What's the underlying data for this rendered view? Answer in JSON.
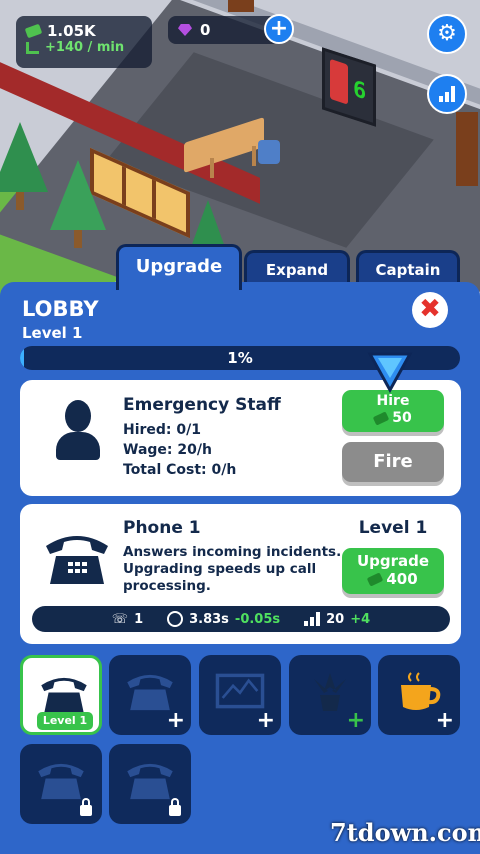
{
  "hud": {
    "money": "1.05K",
    "rate": "+140 / min",
    "gems": "0",
    "add_label": "+",
    "settings_icon": "gear-icon",
    "stats_icon": "bar-chart-icon"
  },
  "scene": {
    "counter_value": "6"
  },
  "tabs": [
    {
      "label": "Upgrade",
      "active": true
    },
    {
      "label": "Expand",
      "active": false
    },
    {
      "label": "Captain",
      "active": false
    }
  ],
  "panel": {
    "title": "LOBBY",
    "level": "Level 1",
    "progress_pct": 1,
    "progress_label": "1%",
    "close_label": "✖"
  },
  "staff": {
    "name": "Emergency Staff",
    "hired": "Hired: 0/1",
    "wage": "Wage: 20/h",
    "total_cost": "Total Cost: 0/h",
    "hire_label": "Hire",
    "hire_cost": "50",
    "fire_label": "Fire"
  },
  "item": {
    "name": "Phone 1",
    "level": "Level 1",
    "desc_line1": "Answers incoming incidents.",
    "desc_line2": "Upgrading speeds up call",
    "desc_line3": "processing.",
    "upgrade_label": "Upgrade",
    "upgrade_cost": "400",
    "stat_calls": "1",
    "stat_time": "3.83s",
    "stat_time_delta": "-0.05s",
    "stat_income": "20",
    "stat_income_delta": "+4"
  },
  "slots": [
    {
      "icon": "phone-icon",
      "state": "selected",
      "badge": "Level 1"
    },
    {
      "icon": "phone-icon",
      "state": "buy"
    },
    {
      "icon": "map-icon",
      "state": "buy"
    },
    {
      "icon": "plant-icon",
      "state": "buy-green"
    },
    {
      "icon": "coffee-icon",
      "state": "buy"
    },
    {
      "icon": "phone-icon",
      "state": "locked"
    },
    {
      "icon": "phone-icon",
      "state": "locked"
    }
  ],
  "watermark": "7tdown.com",
  "colors": {
    "panel": "#2e66c9",
    "dark": "#0f2a5c",
    "green": "#38c34b",
    "accent": "#1e7ff0"
  }
}
